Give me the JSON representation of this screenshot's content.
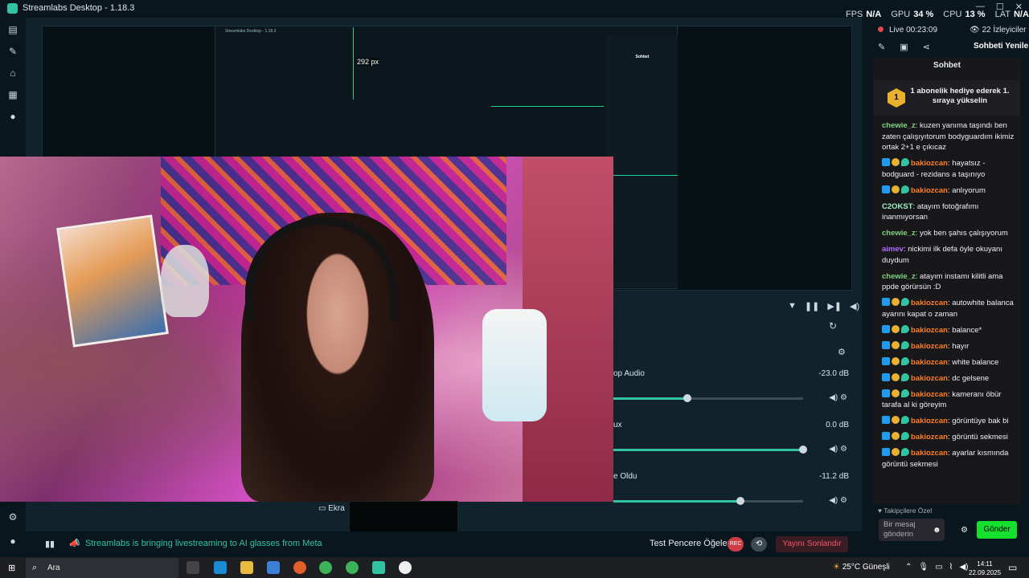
{
  "window": {
    "title": "Streamlabs Desktop - 1.18.3"
  },
  "window_controls": {
    "minimize": "—",
    "maximize": "☐",
    "close": "✕"
  },
  "perf": {
    "fps_label": "FPS",
    "fps_value": "N/A",
    "gpu_label": "GPU",
    "gpu_value": "34 %",
    "cpu_label": "CPU",
    "cpu_value": "13 %",
    "lat_label": "LAT",
    "lat_value": "N/A"
  },
  "leftnav": {
    "icons": [
      "editor-icon",
      "themes-icon",
      "store-icon",
      "media-icon",
      "play-icon",
      "settings-icon",
      "profile-icon"
    ]
  },
  "preview": {
    "nested_title": "Streamlabs Desktop - 1.18.3",
    "nested_chat_header": "Sohbet",
    "guide_label": "292 px"
  },
  "mixer": {
    "channels": [
      {
        "name": "op Audio",
        "db": "-23.0 dB",
        "level": 0.39
      },
      {
        "name": "ux",
        "db": "0.0 dB",
        "level": 1.0
      },
      {
        "name": "e Oldu",
        "db": "-11.2 dB",
        "level": 0.67
      }
    ]
  },
  "source_tab": {
    "label": "Ekra"
  },
  "bottom": {
    "news": "Streamlabs is bringing livestreaming to AI glasses from Meta",
    "test_label": "Test Pencere Öğeleri",
    "rec_label": "REC",
    "end_stream": "Yayını Sonlandır"
  },
  "live": {
    "status": "Live 00:23:09",
    "viewers": "22 İzleyiciler",
    "refresh": "Sohbeti Yenile"
  },
  "chat": {
    "header": "Sohbet",
    "sub_badge": "1",
    "sub_banner": "1 abonelik hediye ederek 1. sıraya yükselin",
    "messages": [
      {
        "user": "chewie_z",
        "color": "#7fd27f",
        "badges": [],
        "text": ": kuzen yanıma taşındı ben zaten çalışıyıtorum bodyguardım ikimiz ortak 2+1 e çıkıcaz"
      },
      {
        "user": "bakiozcan",
        "color": "#ff7f24",
        "badges": [
          "mod",
          "sub",
          "gem"
        ],
        "text": ": hayatsız - bodguard - rezidans a taşınıyo"
      },
      {
        "user": "bakiozcan",
        "color": "#ff7f24",
        "badges": [
          "mod",
          "sub",
          "gem"
        ],
        "text": ": anlıyorum"
      },
      {
        "user": "C2OKST",
        "color": "#9cf0c2",
        "badges": [],
        "text": ": atayım fotoğrafımı inanmıyorsan"
      },
      {
        "user": "chewie_z",
        "color": "#7fd27f",
        "badges": [],
        "text": ": yok ben şahıs çalışıyorum"
      },
      {
        "user": "aimev",
        "color": "#b26bff",
        "badges": [],
        "text": ": nickimi ilk defa öyle okuyanı duydum"
      },
      {
        "user": "chewie_z",
        "color": "#7fd27f",
        "badges": [],
        "text": ": atayım instamı kilitli ama ppde görürsün :D"
      },
      {
        "user": "bakiozcan",
        "color": "#ff7f24",
        "badges": [
          "mod",
          "sub",
          "gem"
        ],
        "text": ": autowhite balanca ayarını kapat o zaman"
      },
      {
        "user": "bakiozcan",
        "color": "#ff7f24",
        "badges": [
          "mod",
          "sub",
          "gem"
        ],
        "text": ": balance*"
      },
      {
        "user": "bakiozcan",
        "color": "#ff7f24",
        "badges": [
          "mod",
          "sub",
          "gem"
        ],
        "text": ": hayır"
      },
      {
        "user": "bakiozcan",
        "color": "#ff7f24",
        "badges": [
          "mod",
          "sub",
          "gem"
        ],
        "text": ": white balance"
      },
      {
        "user": "bakiozcan",
        "color": "#ff7f24",
        "badges": [
          "mod",
          "sub",
          "gem"
        ],
        "text": ": dc gelsene"
      },
      {
        "user": "bakiozcan",
        "color": "#ff7f24",
        "badges": [
          "mod",
          "sub",
          "gem"
        ],
        "text": ": kameranı öbür tarafa al ki göreyim"
      },
      {
        "user": "bakiozcan",
        "color": "#ff7f24",
        "badges": [
          "mod",
          "sub",
          "gem"
        ],
        "text": ": görüntüye bak bi"
      },
      {
        "user": "bakiozcan",
        "color": "#ff7f24",
        "badges": [
          "mod",
          "sub",
          "gem"
        ],
        "text": ": görüntü sekmesi"
      },
      {
        "user": "bakiozcan",
        "color": "#ff7f24",
        "badges": [
          "mod",
          "sub",
          "gem"
        ],
        "text": ": ayarlar kısmında görüntü sekmesi"
      }
    ],
    "followers_only": "Takipçilere Özel",
    "input_placeholder": "Bir mesaj gönderin",
    "send": "Gönder"
  },
  "taskbar": {
    "search": "Ara",
    "weather": "25°C Güneşli",
    "time": "14:11",
    "date": "22.09.2025"
  },
  "colors": {
    "accent": "#31c3a2",
    "send": "#15e02e",
    "live": "#e0464d",
    "end": "#f3566b"
  }
}
